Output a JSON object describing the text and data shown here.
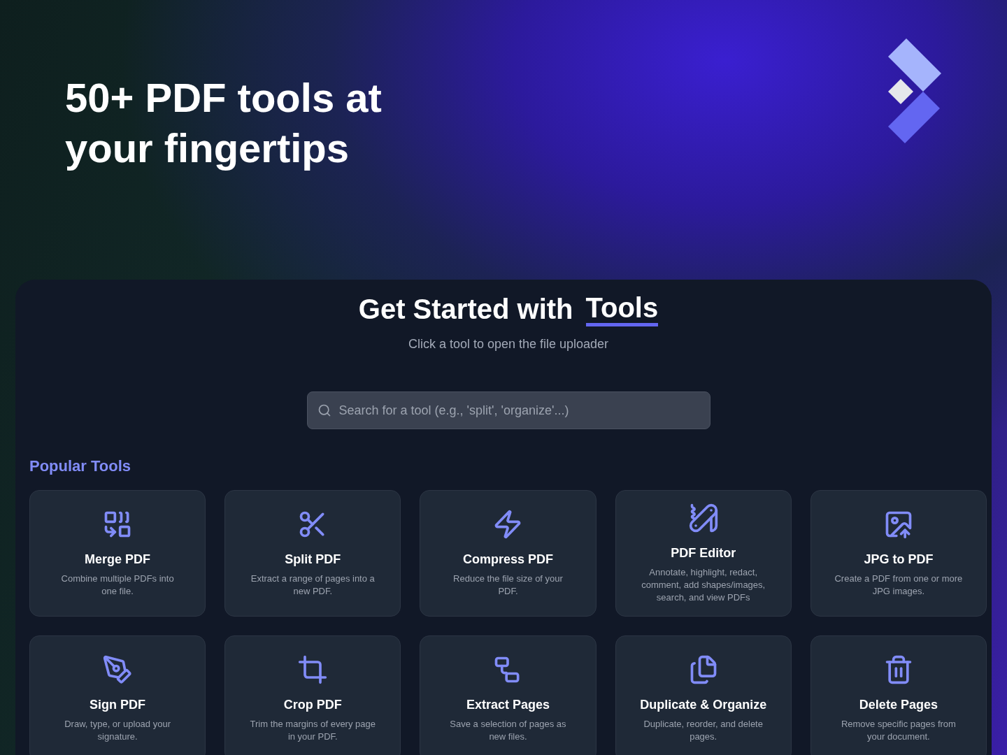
{
  "hero": {
    "title_lines": [
      "50+ PDF tools at",
      "your fingertips"
    ]
  },
  "panel": {
    "heading": "Get Started with",
    "heading_highlight": "Tools",
    "subtitle": "Click a tool to open the file uploader",
    "search": {
      "placeholder": "Search for a tool (e.g., 'split', 'organize'...)"
    }
  },
  "section_title": "Popular Tools",
  "tools": [
    {
      "kind": "merge",
      "title": "Merge PDF",
      "description": "Combine multiple PDFs into one file."
    },
    {
      "kind": "split",
      "title": "Split PDF",
      "description": "Extract a range of pages into a new PDF."
    },
    {
      "kind": "compress",
      "title": "Compress PDF",
      "description": "Reduce the file size of your PDF."
    },
    {
      "kind": "editor",
      "title": "PDF Editor",
      "description": "Annotate, highlight, redact, comment, add shapes/images, search, and view PDFs"
    },
    {
      "kind": "jpg",
      "title": "JPG to PDF",
      "description": "Create a PDF from one or more JPG images."
    },
    {
      "kind": "sign",
      "title": "Sign PDF",
      "description": "Draw, type, or upload your signature."
    },
    {
      "kind": "crop",
      "title": "Crop PDF",
      "description": "Trim the margins of every page in your PDF."
    },
    {
      "kind": "extract",
      "title": "Extract Pages",
      "description": "Save a selection of pages as new files."
    },
    {
      "kind": "duplicate",
      "title": "Duplicate & Organize",
      "description": "Duplicate, reorder, and delete pages."
    },
    {
      "kind": "delete",
      "title": "Delete Pages",
      "description": "Remove specific pages from your document."
    }
  ]
}
